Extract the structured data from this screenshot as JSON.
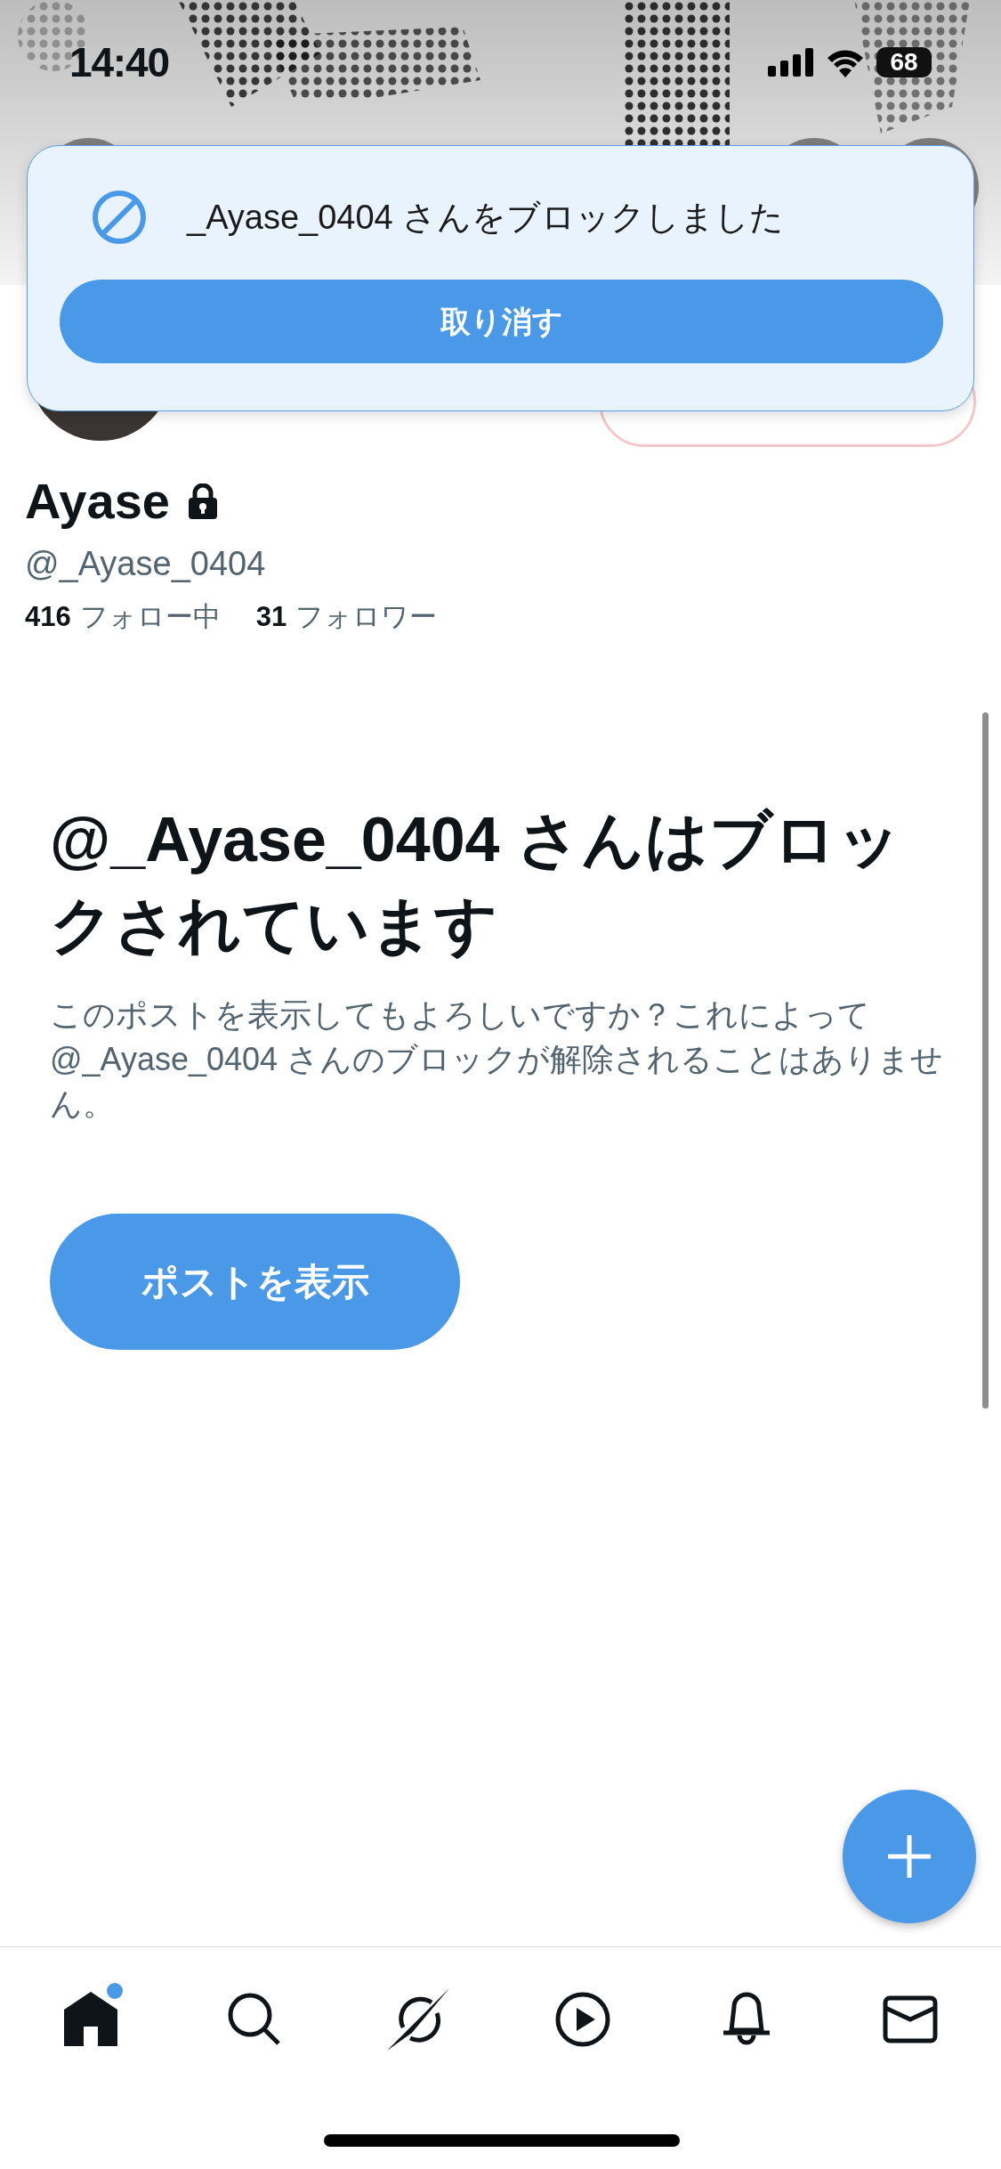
{
  "status_bar": {
    "time": "14:40",
    "battery": "68"
  },
  "toast": {
    "message": "_Ayase_0404 さんをブロックしました",
    "action": "取り消す"
  },
  "profile": {
    "name": "Ayase",
    "protected": true,
    "handle": "@_Ayase_0404",
    "following_count": "416",
    "following_label": "フォロー中",
    "followers_count": "31",
    "followers_label": "フォロワー"
  },
  "blocked_notice": {
    "title": "@_Ayase_0404 さんはブロックされています",
    "body": "このポストを表示してもよろしいですか？これによって@_Ayase_0404 さんのブロックが解除されることはありません。",
    "button": "ポストを表示"
  },
  "tab_bar": [
    {
      "kind": "home",
      "selected": true,
      "unread": true
    },
    {
      "kind": "search",
      "selected": false,
      "unread": false
    },
    {
      "kind": "grok",
      "selected": false,
      "unread": false
    },
    {
      "kind": "video",
      "selected": false,
      "unread": false
    },
    {
      "kind": "notifications",
      "selected": false,
      "unread": false
    },
    {
      "kind": "messages",
      "selected": false,
      "unread": false
    }
  ]
}
